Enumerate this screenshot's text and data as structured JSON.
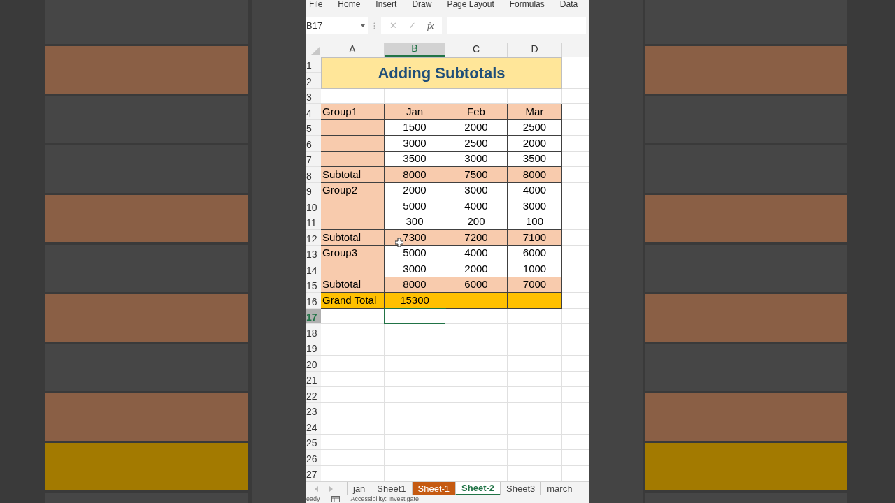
{
  "menu": [
    "File",
    "Home",
    "Insert",
    "Draw",
    "Page Layout",
    "Formulas",
    "Data"
  ],
  "name_box": {
    "value": "B17"
  },
  "formula_bar": {
    "cancel": "✕",
    "enter": "✓",
    "function": "fx"
  },
  "columns": [
    {
      "label": "A",
      "selected": false
    },
    {
      "label": "B",
      "selected": true
    },
    {
      "label": "C",
      "selected": false
    },
    {
      "label": "D",
      "selected": false
    }
  ],
  "title": "Adding Subtotals",
  "rows": [
    {
      "number": "1",
      "kind": "title",
      "selected": false,
      "cells": []
    },
    {
      "number": "2",
      "kind": "title",
      "selected": false,
      "cells": []
    },
    {
      "number": "3",
      "kind": "empty",
      "selected": false,
      "cells": []
    },
    {
      "number": "4",
      "kind": "header",
      "selected": false,
      "cells": [
        "Group1",
        "Jan",
        "Feb",
        "Mar"
      ]
    },
    {
      "number": "5",
      "kind": "data",
      "selected": false,
      "cells": [
        "",
        "1500",
        "2000",
        "2500"
      ]
    },
    {
      "number": "6",
      "kind": "data",
      "selected": false,
      "cells": [
        "",
        "3000",
        "2500",
        "2000"
      ]
    },
    {
      "number": "7",
      "kind": "data",
      "selected": false,
      "cells": [
        "",
        "3500",
        "3000",
        "3500"
      ]
    },
    {
      "number": "8",
      "kind": "subtotal",
      "selected": false,
      "cells": [
        "Subtotal",
        "8000",
        "7500",
        "8000"
      ]
    },
    {
      "number": "9",
      "kind": "data",
      "selected": false,
      "cells": [
        "Group2",
        "2000",
        "3000",
        "4000"
      ]
    },
    {
      "number": "10",
      "kind": "data",
      "selected": false,
      "cells": [
        "",
        "5000",
        "4000",
        "3000"
      ]
    },
    {
      "number": "11",
      "kind": "data",
      "selected": false,
      "cells": [
        "",
        "300",
        "200",
        "100"
      ]
    },
    {
      "number": "12",
      "kind": "subtotal",
      "selected": false,
      "cells": [
        "Subtotal",
        "7300",
        "7200",
        "7100"
      ]
    },
    {
      "number": "13",
      "kind": "data",
      "selected": false,
      "cells": [
        "Group3",
        "5000",
        "4000",
        "6000"
      ]
    },
    {
      "number": "14",
      "kind": "data",
      "selected": false,
      "cells": [
        "",
        "3000",
        "2000",
        "1000"
      ]
    },
    {
      "number": "15",
      "kind": "subtotal",
      "selected": false,
      "cells": [
        "Subtotal",
        "8000",
        "6000",
        "7000"
      ]
    },
    {
      "number": "16",
      "kind": "grand",
      "selected": false,
      "cells": [
        "Grand Total",
        "15300",
        "",
        ""
      ]
    },
    {
      "number": "17",
      "kind": "empty",
      "selected": true,
      "cells": []
    },
    {
      "number": "18",
      "kind": "empty",
      "selected": false,
      "cells": []
    },
    {
      "number": "19",
      "kind": "empty",
      "selected": false,
      "cells": []
    },
    {
      "number": "20",
      "kind": "empty",
      "selected": false,
      "cells": []
    },
    {
      "number": "21",
      "kind": "empty",
      "selected": false,
      "cells": []
    },
    {
      "number": "22",
      "kind": "empty",
      "selected": false,
      "cells": []
    },
    {
      "number": "23",
      "kind": "empty",
      "selected": false,
      "cells": []
    },
    {
      "number": "24",
      "kind": "empty",
      "selected": false,
      "cells": []
    },
    {
      "number": "25",
      "kind": "empty",
      "selected": false,
      "cells": []
    },
    {
      "number": "26",
      "kind": "empty",
      "selected": false,
      "cells": []
    },
    {
      "number": "27",
      "kind": "empty",
      "selected": false,
      "cells": []
    }
  ],
  "sheet_tabs": [
    {
      "label": "jan",
      "selected": false
    },
    {
      "label": "Sheet1",
      "selected": false
    },
    {
      "label": "Sheet-1",
      "selected": false,
      "color": "#c55a11"
    },
    {
      "label": "Sheet-2",
      "selected": true
    },
    {
      "label": "Sheet3",
      "selected": false
    },
    {
      "label": "march",
      "selected": false
    }
  ],
  "status_bar": {
    "mode": "eady",
    "accessibility": "Accessibility: Investigate"
  }
}
